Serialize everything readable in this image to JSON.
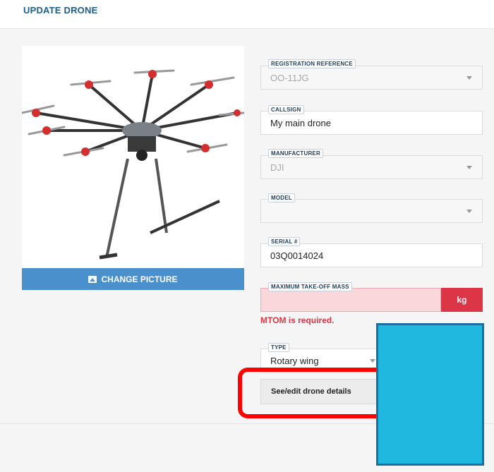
{
  "page": {
    "title": "UPDATE DRONE"
  },
  "photo": {
    "change_label": "CHANGE PICTURE"
  },
  "fields": {
    "registration": {
      "label": "REGISTRATION REFERENCE",
      "value": "OO-11JG"
    },
    "callsign": {
      "label": "CALLSIGN",
      "value": "My main drone"
    },
    "manufacturer": {
      "label": "MANUFACTURER",
      "value": "DJI"
    },
    "model": {
      "label": "MODEL",
      "value": ""
    },
    "serial": {
      "label": "SERIAL #",
      "value": "03Q0014024"
    },
    "mtom": {
      "label": "MAXIMUM TAKE-OFF MASS",
      "value": "",
      "unit": "kg",
      "error": "MTOM is required."
    },
    "type": {
      "label": "TYPE",
      "value": "Rotary wing"
    }
  },
  "actions": {
    "details_label": "See/edit drone details"
  },
  "colors": {
    "accent": "#4a90cc",
    "error": "#dc3545",
    "highlight": "#ff0000",
    "overlay": "#21b8e0"
  },
  "icons": {
    "change_picture": "image-icon"
  }
}
